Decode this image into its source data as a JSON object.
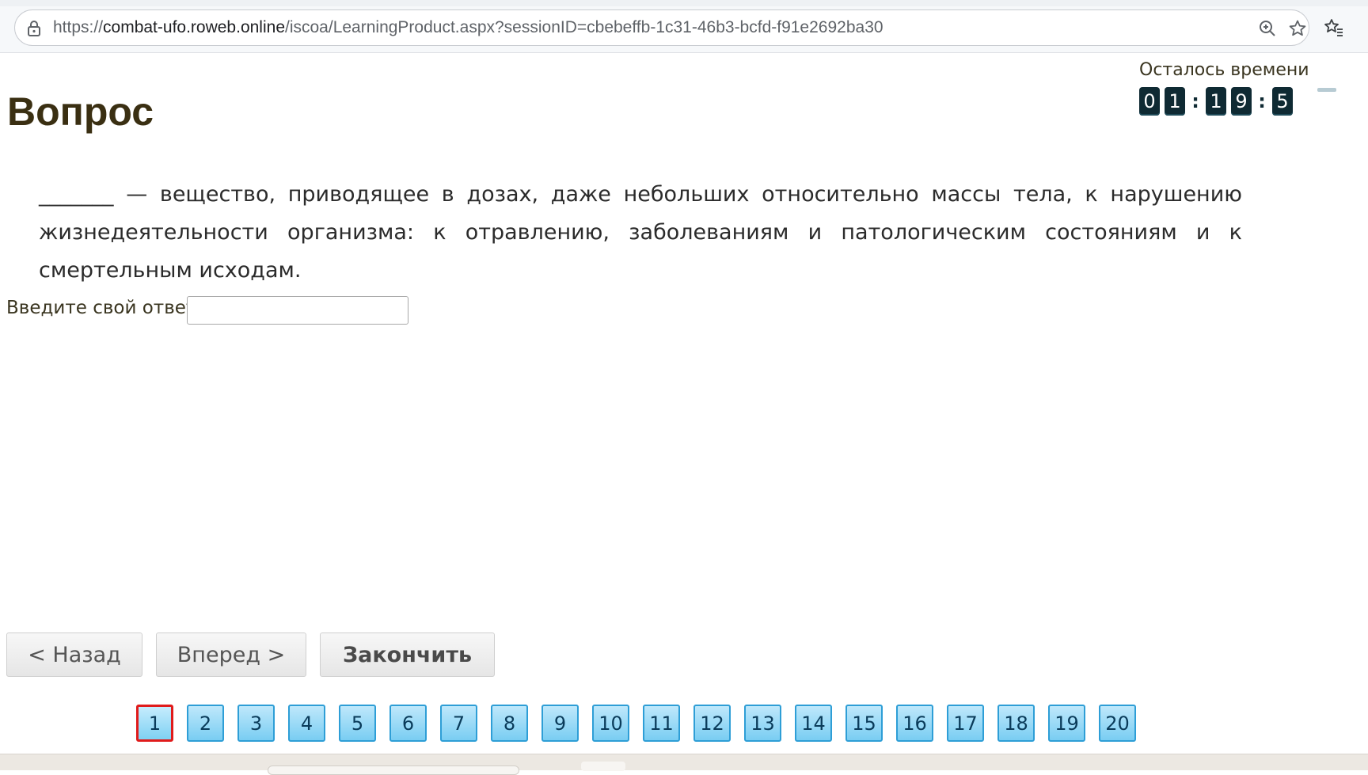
{
  "browser": {
    "url_prefix": "https://",
    "url_host": "combat-ufo.roweb.online",
    "url_path": "/iscoa/LearningProduct.aspx?sessionID=cbebeffb-1c31-46b3-bcfd-f91e2692ba30"
  },
  "timer": {
    "label": "Осталось времени",
    "digits": [
      "0",
      "1",
      "1",
      "9",
      "5"
    ],
    "separator": ":"
  },
  "question": {
    "heading": "Вопрос",
    "text": "_______ — вещество, приводящее в дозах, даже небольших относительно массы тела, к нарушению жизнедеятельности организма: к отравлению, заболеваниям и патологическим состояниям и к смертельным исходам.",
    "answer_label": "Введите свой ответ",
    "answer_value": ""
  },
  "nav": {
    "back": "< Назад",
    "next": "Вперед >",
    "finish": "Закончить"
  },
  "pager": {
    "current": 1,
    "pages": [
      "1",
      "2",
      "3",
      "4",
      "5",
      "6",
      "7",
      "8",
      "9",
      "10",
      "11",
      "12",
      "13",
      "14",
      "15",
      "16",
      "17",
      "18",
      "19",
      "20"
    ]
  },
  "colors": {
    "heading": "#3a2f12",
    "timer_digit_bg": "#0f2a33",
    "page_btn_border": "#2e9ed6",
    "page_btn_active_border": "#e01b1b"
  }
}
